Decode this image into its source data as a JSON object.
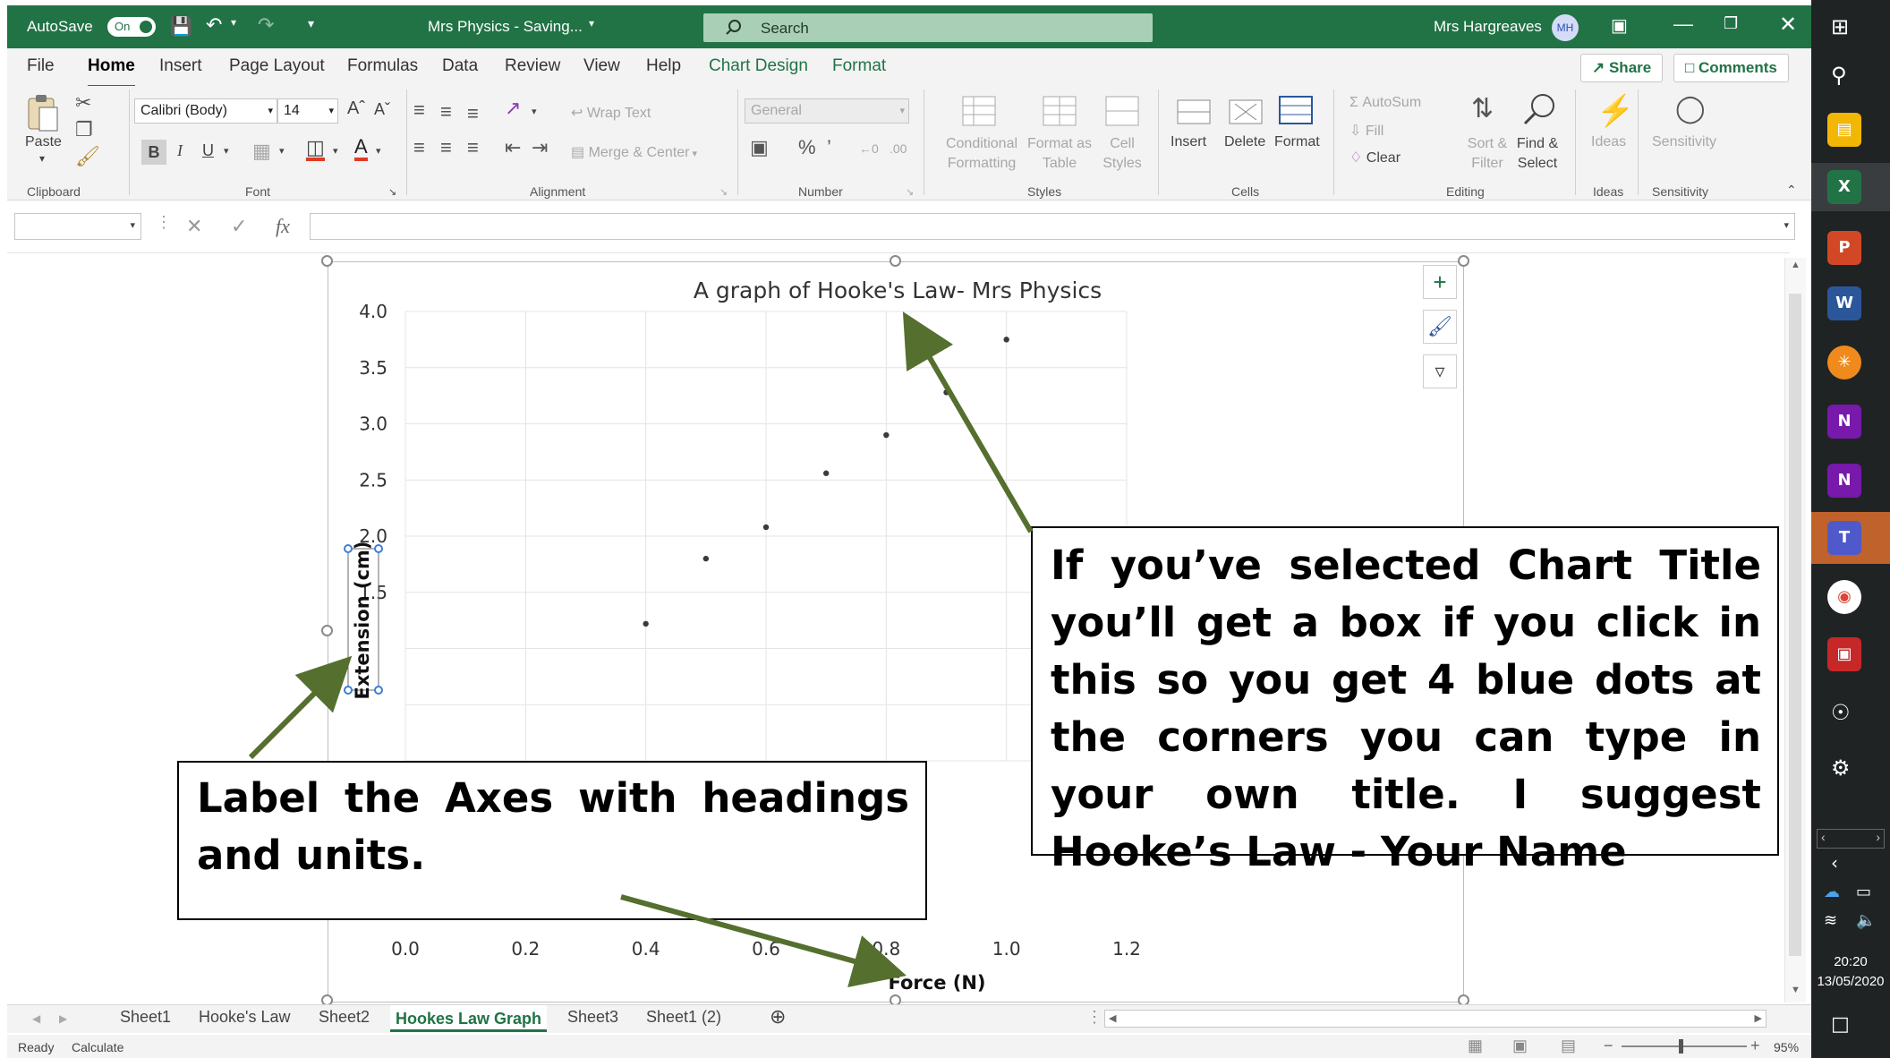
{
  "titlebar": {
    "autosave_label": "AutoSave",
    "autosave_state": "On",
    "doc_title": "Mrs Physics  -  Saving...",
    "search_placeholder": "Search",
    "user_name": "Mrs Hargreaves",
    "user_initials": "MH"
  },
  "tabs": [
    "File",
    "Home",
    "Insert",
    "Page Layout",
    "Formulas",
    "Data",
    "Review",
    "View",
    "Help",
    "Chart Design",
    "Format"
  ],
  "share_label": "Share",
  "comments_label": "Comments",
  "ribbon": {
    "clipboard": {
      "paste": "Paste",
      "label": "Clipboard"
    },
    "font": {
      "name": "Calibri (Body)",
      "size": "14",
      "bold": "B",
      "italic": "I",
      "underline": "U",
      "label": "Font"
    },
    "alignment": {
      "wrap": "Wrap Text",
      "merge": "Merge & Center",
      "label": "Alignment"
    },
    "number": {
      "format": "General",
      "label": "Number"
    },
    "styles": {
      "conditional_1": "Conditional",
      "conditional_2": "Formatting",
      "format_as_1": "Format as",
      "format_as_2": "Table",
      "cell_1": "Cell",
      "cell_2": "Styles",
      "label": "Styles"
    },
    "cells": {
      "insert": "Insert",
      "delete": "Delete",
      "format": "Format",
      "label": "Cells"
    },
    "editing": {
      "autosum": "AutoSum",
      "fill": "Fill",
      "clear": "Clear",
      "sort_1": "Sort &",
      "sort_2": "Filter",
      "find_1": "Find &",
      "find_2": "Select",
      "label": "Editing"
    },
    "ideas": {
      "name": "Ideas",
      "label": "Ideas"
    },
    "sensitivity": {
      "name": "Sensitivity",
      "label": "Sensitivity"
    }
  },
  "formula_bar": {
    "fx": "fx"
  },
  "chart_data": {
    "type": "scatter",
    "title": "A graph of Hooke's Law- Mrs Physics",
    "xlabel": "Force (N)",
    "ylabel": "Extension (cm)",
    "xlim": [
      0,
      1.2
    ],
    "ylim": [
      0,
      4.0
    ],
    "x_ticks": [
      "0.0",
      "0.2",
      "0.4",
      "0.6",
      "0.8",
      "1.0",
      "1.2"
    ],
    "y_ticks": [
      "1.5",
      "2.0",
      "2.5",
      "3.0",
      "3.5",
      "4.0"
    ],
    "grid": true,
    "x": [
      0.4,
      0.5,
      0.6,
      0.7,
      0.8,
      0.9,
      1.0
    ],
    "y": [
      1.22,
      1.8,
      2.08,
      2.56,
      2.9,
      3.28,
      3.75
    ]
  },
  "callouts": {
    "title_hint": "If you’ve selected Chart Title you’ll get a box if you click in this so you get 4 blue dots at the corners you can type in your own title. I suggest Hooke’s Law - Your Name",
    "axes_hint": "Label the Axes with headings and units."
  },
  "sheet_tabs": [
    "Sheet1",
    "Hooke's Law",
    "Sheet2",
    "Hookes Law Graph",
    "Sheet3",
    "Sheet1 (2)"
  ],
  "active_sheet": "Hookes Law Graph",
  "status": {
    "ready": "Ready",
    "calculate": "Calculate",
    "zoom": "95%"
  },
  "taskbar": {
    "time": "20:20",
    "date": "13/05/2020"
  },
  "colors": {
    "excel_green": "#217346",
    "arrow_green": "#556f2f"
  }
}
